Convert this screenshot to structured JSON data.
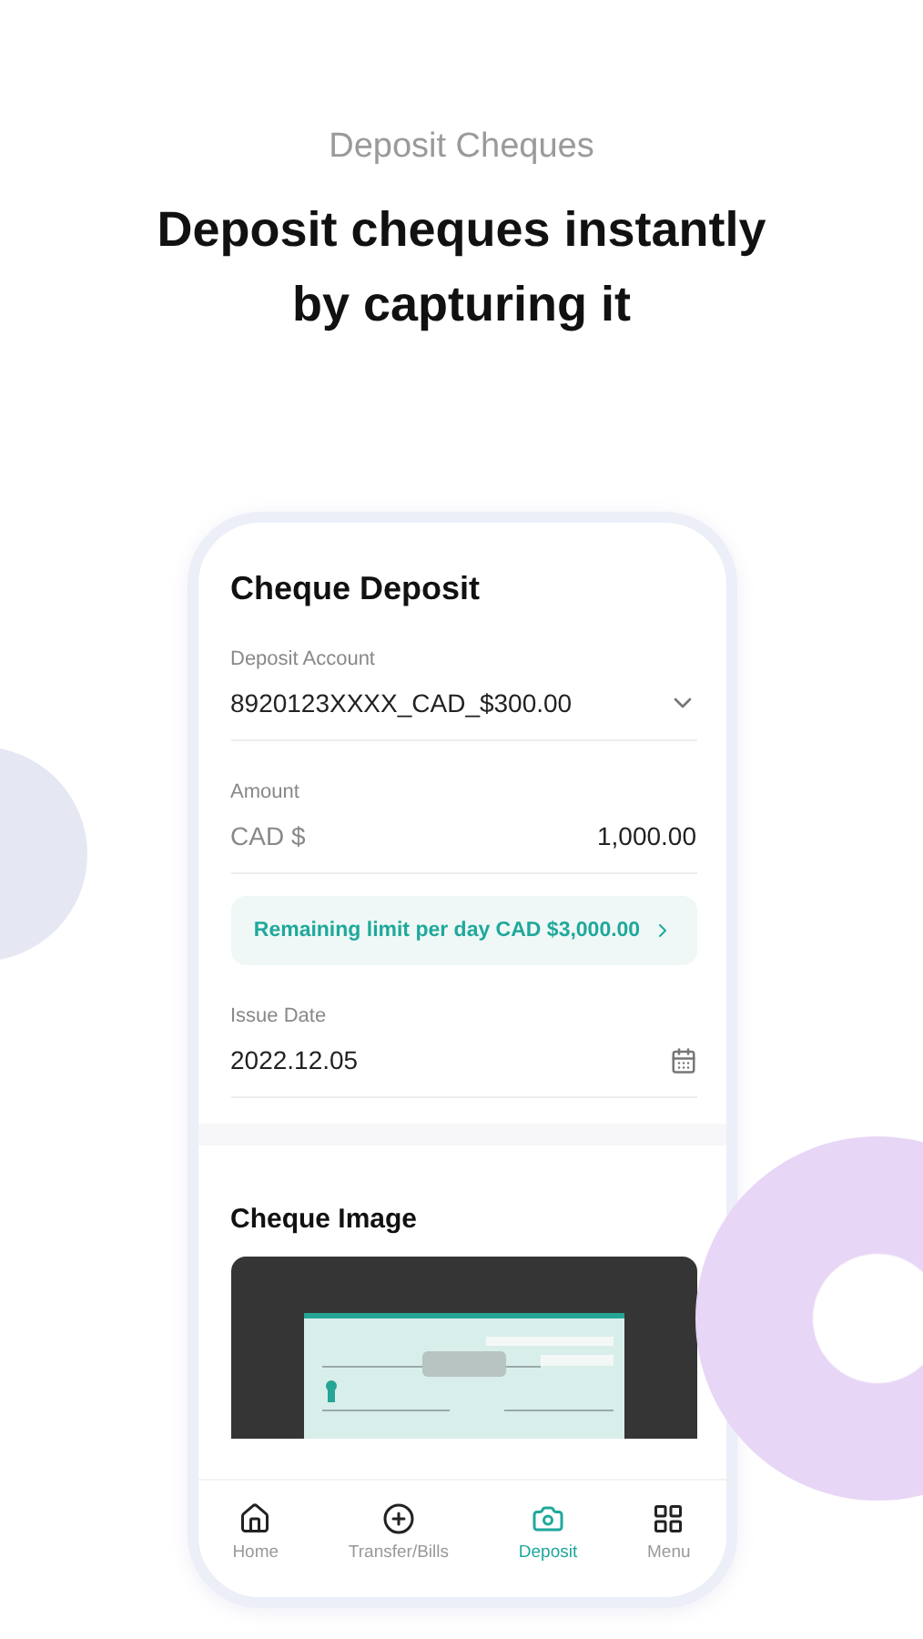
{
  "header": {
    "category": "Deposit Cheques",
    "headline": "Deposit cheques instantly by capturing it"
  },
  "screen": {
    "title": "Cheque Deposit",
    "deposit_account": {
      "label": "Deposit Account",
      "value": "8920123XXXX_CAD_$300.00"
    },
    "amount": {
      "label": "Amount",
      "currency": "CAD $",
      "value": "1,000.00"
    },
    "limit_notice": {
      "text": "Remaining limit per day CAD $3,000.00"
    },
    "issue_date": {
      "label": "Issue Date",
      "value": "2022.12.05"
    },
    "cheque_image": {
      "title": "Cheque Image",
      "kind": "picture"
    }
  },
  "nav": [
    {
      "kind": "home",
      "label": "Home",
      "selected": false
    },
    {
      "kind": "transfer",
      "label": "Transfer/Bills",
      "selected": false
    },
    {
      "kind": "deposit",
      "label": "Deposit",
      "selected": true
    },
    {
      "kind": "menu",
      "label": "Menu",
      "selected": false
    }
  ]
}
